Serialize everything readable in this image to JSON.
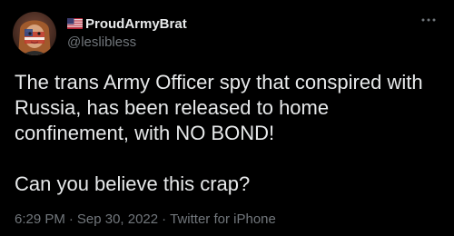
{
  "tweet": {
    "author": {
      "display_name": "ProudArmyBrat",
      "handle": "@leslibless",
      "flag_icon": "us-flag-icon",
      "avatar_icon": "avatar"
    },
    "menu_icon": "more-horizontal-icon",
    "paragraphs": [
      "The trans Army Officer spy that conspired with Russia, has been released to home confinement, with NO BOND!",
      "Can you believe this crap?"
    ],
    "time": "6:29 PM",
    "date": "Sep 30, 2022",
    "source": "Twitter for iPhone",
    "separator": "·"
  },
  "colors": {
    "background": "#000000",
    "primary_text": "#e7e9ea",
    "secondary_text": "#71767b"
  }
}
